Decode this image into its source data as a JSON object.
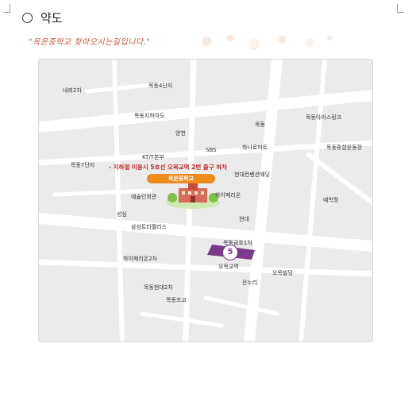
{
  "header": {
    "title": "약도",
    "tagline": "\"목운중학교 찾아오시는길입니다.\""
  },
  "map": {
    "direction_note": "- 지하철 이용시 5호선 오목교역 2번 출구 하차",
    "school_label": "목운중학교",
    "subway_line": "5",
    "subway_color": "#7a3a8a",
    "accent_color": "#f08b1e",
    "labels": {
      "naerae2cha": "내뢰2차",
      "mokdong4": "목동4단지",
      "mokdong_underpass": "목동지하차도",
      "yangcheon": "양천",
      "mokdong": "목동",
      "mokdong_icerink": "목동아이스링크",
      "sbs": "SBS",
      "hanaromart": "하나로마트",
      "mokdong_stadium": "목동종합운동장",
      "kt_hq": "KT/T본부",
      "mokdong7": "목동7단지",
      "wedding": "현대컨벤션웨딩",
      "artcenter": "예술인회관",
      "hyperion": "하이페리온",
      "yeokhakjang": "예학정",
      "seongsim": "성심",
      "trapalace": "삼성트라팰리스",
      "hyundai": "현대",
      "geumho1": "목동금호1차",
      "hyperion2": "하이페리온2차",
      "omokgyo": "오목교역",
      "omok_building": "오목빌딩",
      "eunnuri": "은누리",
      "hyundai2": "목동현대2차",
      "mokdong_elem": "목동초교"
    }
  }
}
